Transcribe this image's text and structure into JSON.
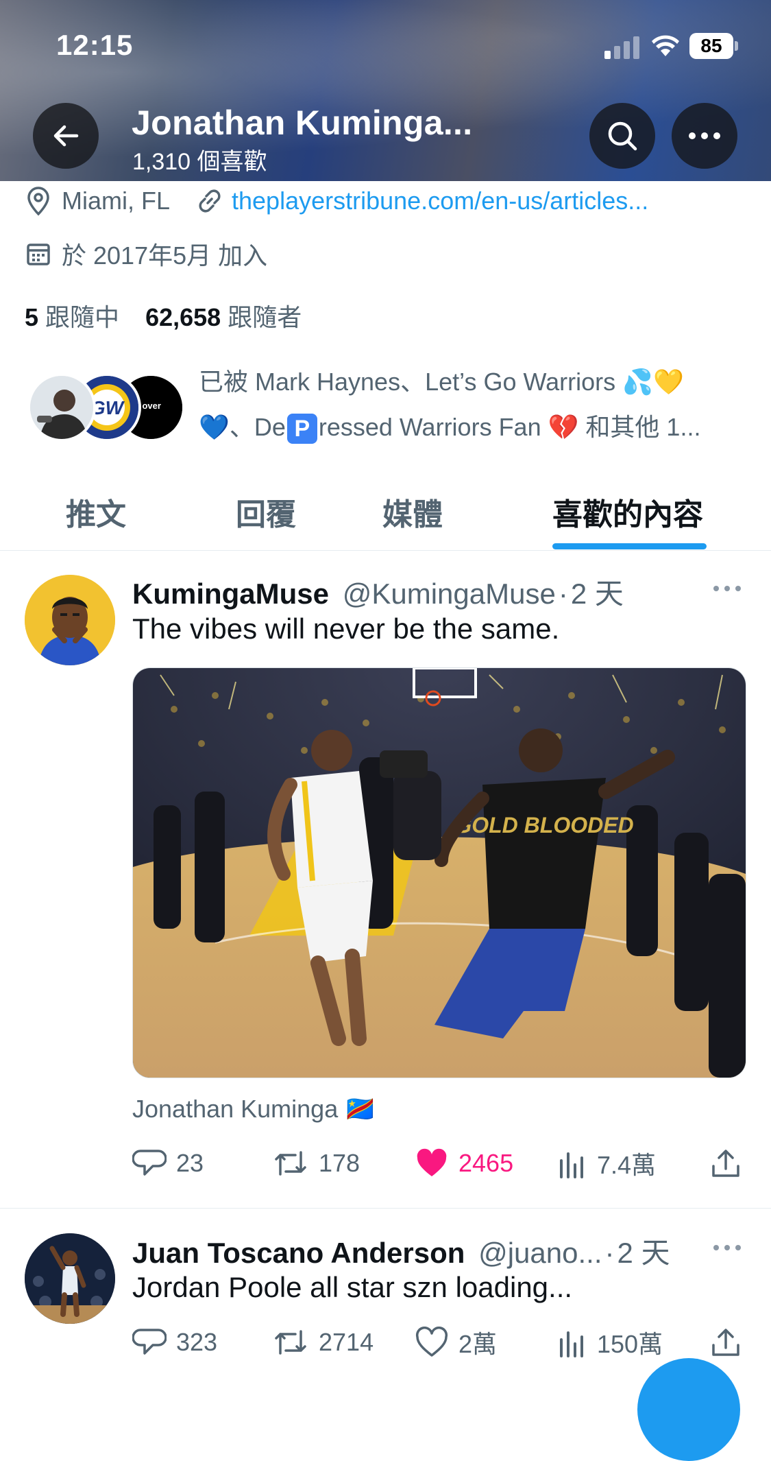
{
  "status_bar": {
    "time": "12:15",
    "battery": "85"
  },
  "header": {
    "name": "Jonathan Kuminga...",
    "likes_count": "1,310 個喜歡"
  },
  "profile": {
    "location": "Miami, FL",
    "website": "theplayerstribune.com/en-us/articles...",
    "joined": "於 2017年5月 加入",
    "following_count": "5",
    "following_label": "跟隨中",
    "followers_count": "62,658",
    "followers_label": "跟隨者",
    "followed_by_line1": "已被 Mark Haynes、Let’s Go Warriors 💦💛",
    "followed_by_line2a": "💙、De",
    "followed_by_badge": "P",
    "followed_by_line2b": "ressed Warriors Fan 💔 和其他 1...",
    "avatar2_text": "GW",
    "avatar3_text": "is over"
  },
  "tabs": [
    {
      "label": "推文"
    },
    {
      "label": "回覆"
    },
    {
      "label": "媒體"
    },
    {
      "label": "喜歡的內容",
      "active": true
    }
  ],
  "tweets": [
    {
      "name": "KumingaMuse",
      "handle": "@KumingaMuse",
      "sep": "·",
      "time": "2 天",
      "text": "The vibes will never be the same.",
      "media_jersey_text": "GOLD BLOODED",
      "attribution": "Jonathan Kuminga 🇨🇩",
      "replies": "23",
      "retweets": "178",
      "likes": "2465",
      "views": "7.4萬",
      "liked": true
    },
    {
      "name": "Juan Toscano Anderson",
      "handle": "@juano...",
      "sep": "·",
      "time": "2 天",
      "text": "Jordan Poole all star szn loading...",
      "replies": "323",
      "retweets": "2714",
      "likes": "2萬",
      "views": "150萬",
      "liked": false
    }
  ],
  "colors": {
    "accent": "#1d9bf0",
    "like": "#f91880",
    "secondary_text": "#536471"
  }
}
